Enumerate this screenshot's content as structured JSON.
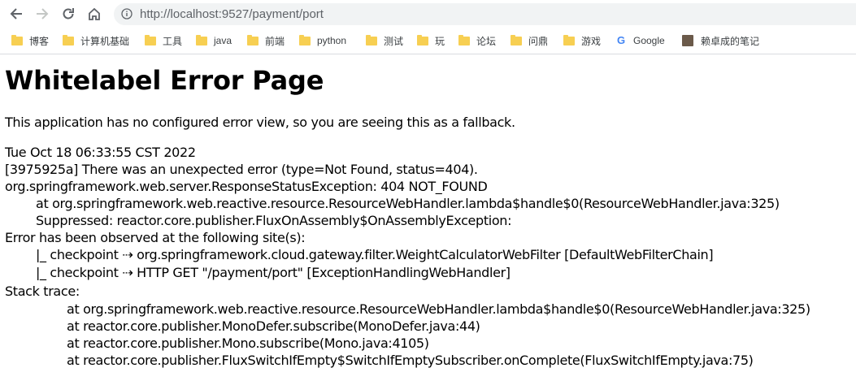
{
  "browser": {
    "url": "http://localhost:9527/payment/port",
    "bookmarks": [
      "博客",
      "计算机基础",
      "工具",
      "java",
      "前端",
      "python",
      "测试",
      "玩",
      "论坛",
      "问鼎",
      "游戏",
      "Google",
      "赖卓成的笔记"
    ]
  },
  "page": {
    "title": "Whitelabel Error Page",
    "intro": "This application has no configured error view, so you are seeing this as a fallback.",
    "timestamp": "Tue Oct 18 06:33:55 CST 2022",
    "error_line": "[3975925a] There was an unexpected error (type=Not Found, status=404).",
    "exception": "org.springframework.web.server.ResponseStatusException: 404 NOT_FOUND",
    "at_handler": "at org.springframework.web.reactive.resource.ResourceWebHandler.lambda$handle$0(ResourceWebHandler.java:325)",
    "suppressed": "Suppressed: reactor.core.publisher.FluxOnAssembly$OnAssemblyException:",
    "observed": "Error has been observed at the following site(s):",
    "checkpoint1": "|_ checkpoint ⇢ org.springframework.cloud.gateway.filter.WeightCalculatorWebFilter [DefaultWebFilterChain]",
    "checkpoint2": "|_ checkpoint ⇢ HTTP GET \"/payment/port\" [ExceptionHandlingWebHandler]",
    "stack_label": "Stack trace:",
    "stack": [
      "at org.springframework.web.reactive.resource.ResourceWebHandler.lambda$handle$0(ResourceWebHandler.java:325)",
      "at reactor.core.publisher.MonoDefer.subscribe(MonoDefer.java:44)",
      "at reactor.core.publisher.Mono.subscribe(Mono.java:4105)",
      "at reactor.core.publisher.FluxSwitchIfEmpty$SwitchIfEmptySubscriber.onComplete(FluxSwitchIfEmpty.java:75)"
    ]
  }
}
